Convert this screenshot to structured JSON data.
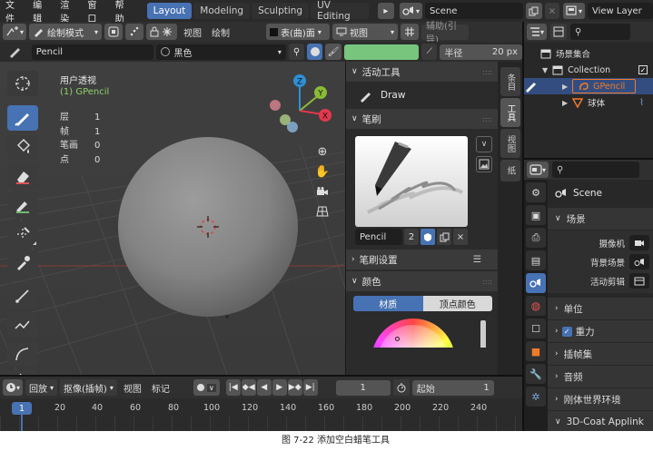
{
  "menubar": {
    "items": [
      "文件",
      "编辑",
      "渲染",
      "窗口",
      "帮助"
    ],
    "workspaces": [
      {
        "label": "Layout",
        "active": true
      },
      {
        "label": "Modeling",
        "active": false
      },
      {
        "label": "Sculpting",
        "active": false
      },
      {
        "label": "UV Editing",
        "active": false
      }
    ],
    "scene": "Scene",
    "view_layer": "View Layer"
  },
  "viewport_header": {
    "mode": "绘制模式",
    "view": "视图",
    "draw": "绘制",
    "stroke_mode": "表(曲)面",
    "view2": "视图",
    "guides": "辅助(引导)"
  },
  "toolset": {
    "brush": "Pencil",
    "material": "黑色",
    "radius_label": "半径",
    "radius_value": "20 px"
  },
  "viewport": {
    "view_name": "用户透视",
    "object_name": "(1) GPencil",
    "stats": [
      {
        "label": "层",
        "value": "1"
      },
      {
        "label": "帧",
        "value": "1"
      },
      {
        "label": "笔画",
        "value": "0"
      },
      {
        "label": "点",
        "value": "0"
      }
    ],
    "gizmo": {
      "x": "X",
      "y": "Y",
      "z": "Z"
    }
  },
  "sidepanel": {
    "active_tool_title": "活动工具",
    "active_tool": "Draw",
    "brush_title": "笔刷",
    "brush_name": "Pencil",
    "brush_users": "2",
    "brush_settings_title": "笔刷设置",
    "color_title": "颜色",
    "color_tabs": [
      "材质",
      "顶点颜色"
    ],
    "tabs": [
      {
        "label": "条目",
        "active": false
      },
      {
        "label": "工具",
        "active": true
      },
      {
        "label": "视图",
        "active": false
      },
      {
        "label": "纸",
        "active": false
      }
    ]
  },
  "outliner": {
    "root": "场景集合",
    "collection": "Collection",
    "gpencil": "GPencil",
    "sphere": "球体"
  },
  "properties": {
    "scene_title": "Scene",
    "scene_section": "场景",
    "camera_label": "摄像机",
    "bg_scene_label": "背景场景",
    "active_clip_label": "活动剪辑",
    "sections": [
      "单位",
      "重力",
      "插帧集",
      "音频",
      "刚体世界环境",
      "3D-Coat Applink"
    ]
  },
  "timeline": {
    "playback": "回放",
    "keying": "抠像(插帧)",
    "view": "视图",
    "marker": "标记",
    "current_frame": "1",
    "start_label": "起始",
    "start_value": "1",
    "frames": [
      "1",
      "20",
      "40",
      "60",
      "80",
      "100",
      "120",
      "140",
      "160",
      "180",
      "200",
      "220",
      "240"
    ]
  },
  "caption": "图 7-22  添加空白蜡笔工具",
  "colors": {
    "accent": "#4772b3",
    "x_axis": "#e2384c",
    "y_axis": "#8bbb35",
    "z_axis": "#2d8fd6",
    "gpencil_highlight": "#f07a2a"
  }
}
